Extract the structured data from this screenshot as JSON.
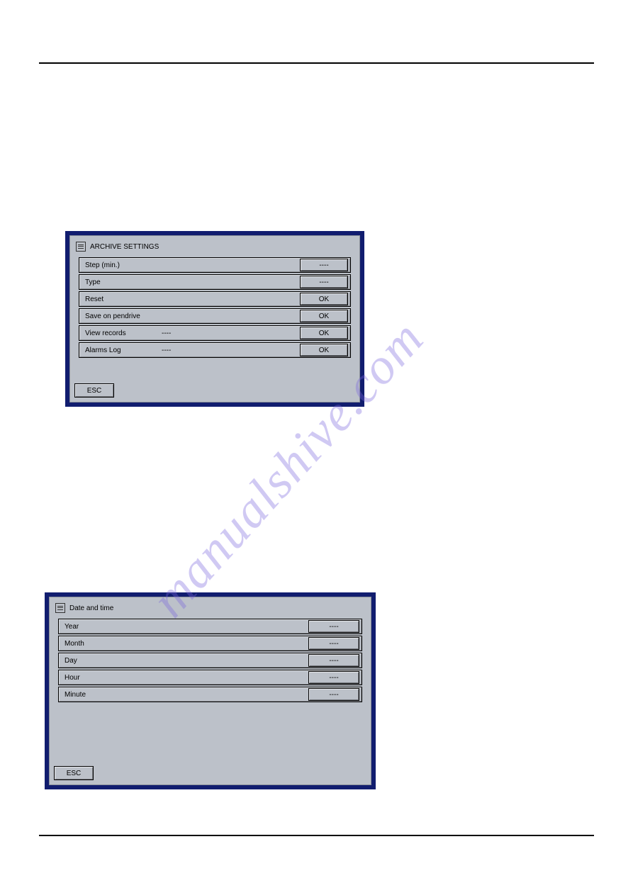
{
  "watermark": "manualshive.com",
  "panel1": {
    "title": "ARCHIVE SETTINGS",
    "rows": [
      {
        "label": "Step (min.)",
        "mid": "",
        "btn": "----"
      },
      {
        "label": "Type",
        "mid": "",
        "btn": "----"
      },
      {
        "label": "Reset",
        "mid": "",
        "btn": "OK"
      },
      {
        "label": "Save on pendrive",
        "mid": "",
        "btn": "OK"
      },
      {
        "label": "View records",
        "mid": "----",
        "btn": "OK"
      },
      {
        "label": "Alarms Log",
        "mid": "----",
        "btn": "OK"
      }
    ],
    "esc": "ESC"
  },
  "panel2": {
    "title": "Date and time",
    "rows": [
      {
        "label": "Year",
        "mid": "",
        "btn": "----"
      },
      {
        "label": "Month",
        "mid": "",
        "btn": "----"
      },
      {
        "label": "Day",
        "mid": "",
        "btn": "----"
      },
      {
        "label": "Hour",
        "mid": "",
        "btn": "----"
      },
      {
        "label": "Minute",
        "mid": "",
        "btn": "----"
      }
    ],
    "esc": "ESC"
  }
}
